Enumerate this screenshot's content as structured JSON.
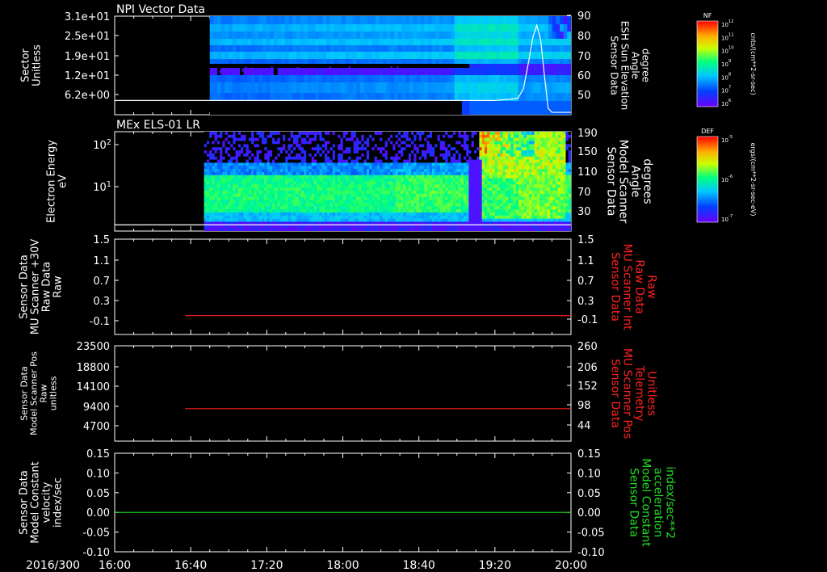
{
  "time_axis": {
    "year_doy": "2016/300",
    "ticks": [
      "16:00",
      "16:40",
      "17:20",
      "18:00",
      "18:40",
      "19:20",
      "20:00"
    ],
    "range_minutes": [
      0,
      240
    ]
  },
  "chart_data": [
    {
      "type": "heatmap",
      "title": "NPI Vector Data",
      "ylabel_left": [
        "Sector",
        "Unitless"
      ],
      "yticks_left": [
        "3.1e+01",
        "2.5e+01",
        "1.9e+01",
        "1.2e+01",
        "6.2e+00"
      ],
      "ylabel_right": [
        "Sensor Data",
        "ESH Sun Elevation",
        "Angle",
        "degree"
      ],
      "yticks_right": [
        "90",
        "80",
        "70",
        "60",
        "50"
      ],
      "ylim_right": [
        40,
        90
      ],
      "data_start_minute": 50,
      "colorbar": {
        "title": "NF",
        "unit": "cnts/(cm**2-sr-sec)",
        "ticks": [
          "10^12",
          "10^11",
          "10^10",
          "10^9",
          "10^8",
          "10^7",
          "10^6"
        ]
      },
      "series": [
        {
          "color": "#ffffff",
          "x": [
            0,
            200,
            212,
            215,
            218,
            220,
            222,
            224,
            226,
            228,
            230,
            240
          ],
          "y": [
            47,
            47,
            48,
            53,
            68,
            79,
            85,
            78,
            60,
            43,
            41,
            41
          ]
        }
      ]
    },
    {
      "type": "heatmap",
      "title": "MEx ELS-01 LR",
      "ylabel_left": [
        "Electron Energy",
        "eV"
      ],
      "yticks_left": [
        "10^2",
        "10^1"
      ],
      "ylabel_right": [
        "Sensor Data",
        "Model Scanner",
        "Angle",
        "degrees"
      ],
      "yticks_right": [
        "190",
        "150",
        "110",
        "70",
        "30"
      ],
      "ylim_right": [
        0,
        190
      ],
      "data_start_minute": 47,
      "colorbar": {
        "title": "DEF",
        "unit": "ergs/(cm**2-sr-sec-eV)",
        "ticks": [
          "10^-5",
          "10^-6",
          "10^-7"
        ]
      },
      "series": [
        {
          "color": "#ffffff",
          "x": [
            0,
            240
          ],
          "y": [
            12,
            12
          ]
        }
      ]
    },
    {
      "type": "line",
      "ylabel_left": [
        "Sensor Data",
        "MU Scanner +30V",
        "Raw Data",
        "Raw"
      ],
      "ylim_left": [
        -0.3,
        1.5
      ],
      "yticks_left": [
        "1.5",
        "1.1",
        "0.7",
        "0.3",
        "-0.1"
      ],
      "ylabel_right": [
        "Sensor Data",
        "MU Scanner Int",
        "Raw Data",
        "Raw"
      ],
      "yticks_right": [
        "1.5",
        "1.1",
        "0.7",
        "0.3",
        "-0.1"
      ],
      "right_label_color": "#ff2020",
      "series": [
        {
          "color": "#ff2020",
          "x": [
            37,
            240
          ],
          "y": [
            0.0,
            0.0
          ]
        }
      ]
    },
    {
      "type": "line",
      "ylabel_left": [
        "Sensor Data",
        "Model Scanner Pos",
        "Raw",
        "unitless"
      ],
      "ylim_left": [
        0,
        23500
      ],
      "yticks_left": [
        "23500",
        "18800",
        "14100",
        "9400",
        "4700"
      ],
      "ylabel_right": [
        "Sensor Data",
        "MU Scanner Pos",
        "Telemetry",
        "Unitless"
      ],
      "yticks_right": [
        "260",
        "206",
        "152",
        "98",
        "44"
      ],
      "right_label_color": "#ff2020",
      "series": [
        {
          "color": "#ff2020",
          "x": [
            37,
            240
          ],
          "y": [
            8000,
            8000
          ]
        }
      ]
    },
    {
      "type": "line",
      "ylabel_left": [
        "Sensor Data",
        "Model Constant",
        "velocity",
        "index/sec"
      ],
      "ylim_left": [
        -0.1,
        0.15
      ],
      "yticks_left": [
        "0.15",
        "0.10",
        "0.05",
        "0.00",
        "-0.05",
        "-0.10"
      ],
      "ylabel_right": [
        "Sensor Data",
        "Model Constant",
        "acceleration",
        "index/sec**2"
      ],
      "yticks_right": [
        "0.15",
        "0.10",
        "0.05",
        "0.00",
        "-0.05",
        "-0.10"
      ],
      "right_label_color": "#22dd22",
      "series": [
        {
          "color": "#22dd22",
          "x": [
            0,
            240
          ],
          "y": [
            0.0,
            0.0
          ]
        }
      ]
    }
  ]
}
